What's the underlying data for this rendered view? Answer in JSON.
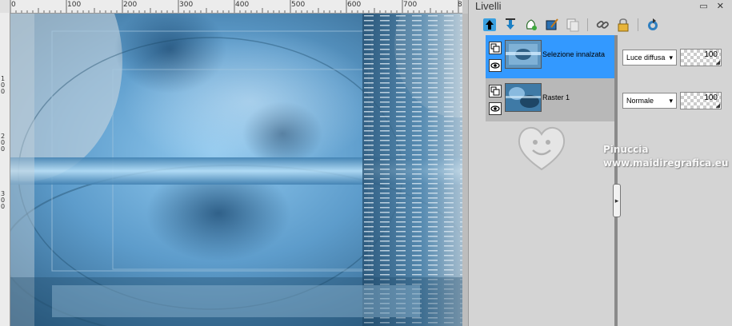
{
  "ruler": {
    "top_labels": [
      "0",
      "100",
      "200",
      "300",
      "400",
      "500",
      "600",
      "700",
      "8"
    ],
    "left_labels": [
      "1",
      "0",
      "0",
      "2",
      "0",
      "0",
      "3",
      "0",
      "0"
    ]
  },
  "panel": {
    "title": "Livelli",
    "controls": "▭ ✕",
    "toolbar_icons": [
      "move-layer-up-icon",
      "move-layer-down-icon",
      "new-layer-icon",
      "edit-layer-icon",
      "duplicate-layer-icon",
      "link-icon",
      "lock-icon",
      "refresh-icon"
    ],
    "accent_selected": "#3399ff",
    "layers": [
      {
        "name": "Selezione innalzata",
        "blend": "Luce diffusa",
        "opacity": "100",
        "selected": true
      },
      {
        "name": "Raster 1",
        "blend": "Normale",
        "opacity": "100",
        "selected": false
      }
    ]
  },
  "watermark": {
    "name": "Pinuccia",
    "url": "www.maidiregrafica.eu"
  }
}
